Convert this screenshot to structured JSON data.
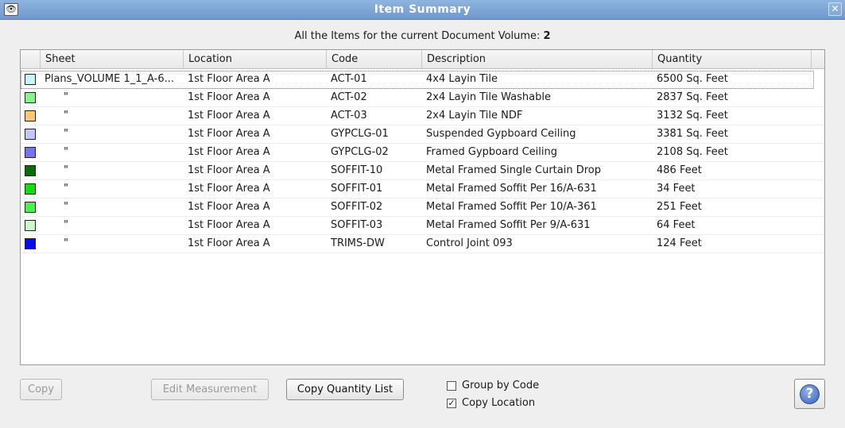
{
  "window": {
    "title": "Item Summary",
    "app_icon": "eye-icon",
    "close_icon": "close-icon",
    "close_glyph": "✕",
    "app_glyph": "👁"
  },
  "header": {
    "label": "All the Items for the current Document Volume:",
    "count": "2"
  },
  "table": {
    "columns": [
      "Sheet",
      "Location",
      "Code",
      "Description",
      "Quantity"
    ],
    "rows": [
      {
        "color": "#c8f4f8",
        "sheet": "Plans_VOLUME 1_1_A-6...",
        "location": "1st Floor Area A",
        "code": "ACT-01",
        "description": "4x4 Layin Tile",
        "quantity": "6500 Sq. Feet"
      },
      {
        "color": "#8ef08e",
        "sheet": "\"",
        "location": "1st Floor Area A",
        "code": "ACT-02",
        "description": "2x4 Layin Tile Washable",
        "quantity": "2837 Sq. Feet"
      },
      {
        "color": "#ffc873",
        "sheet": "\"",
        "location": "1st Floor Area A",
        "code": "ACT-03",
        "description": "2x4 Layin Tile NDF",
        "quantity": "3132 Sq. Feet"
      },
      {
        "color": "#c4c4f6",
        "sheet": "\"",
        "location": "1st Floor Area A",
        "code": "GYPCLG-01",
        "description": "Suspended Gypboard Ceiling",
        "quantity": "3381 Sq. Feet"
      },
      {
        "color": "#7474e8",
        "sheet": "\"",
        "location": "1st Floor Area A",
        "code": "GYPCLG-02",
        "description": "Framed Gypboard Ceiling",
        "quantity": "2108 Sq. Feet"
      },
      {
        "color": "#0a6b0a",
        "sheet": "\"",
        "location": "1st Floor Area A",
        "code": "SOFFIT-10",
        "description": "Metal Framed Single Curtain Drop",
        "quantity": "486 Feet"
      },
      {
        "color": "#11dd11",
        "sheet": "\"",
        "location": "1st Floor Area A",
        "code": "SOFFIT-01",
        "description": "Metal Framed Soffit Per 16/A-631",
        "quantity": "34 Feet"
      },
      {
        "color": "#4eee4e",
        "sheet": "\"",
        "location": "1st Floor Area A",
        "code": "SOFFIT-02",
        "description": "Metal Framed Soffit Per 10/A-361",
        "quantity": "251 Feet"
      },
      {
        "color": "#cdf7cd",
        "sheet": "\"",
        "location": "1st Floor Area A",
        "code": "SOFFIT-03",
        "description": "Metal Framed Soffit Per 9/A-631",
        "quantity": "64 Feet"
      },
      {
        "color": "#0a0aee",
        "sheet": "\"",
        "location": "1st Floor Area A",
        "code": "TRIMS-DW",
        "description": "Control Joint 093",
        "quantity": "124 Feet"
      }
    ]
  },
  "buttons": {
    "copy": "Copy",
    "edit_measurement": "Edit Measurement",
    "copy_quantity_list": "Copy Quantity List",
    "help_glyph": "?"
  },
  "options": {
    "group_by_code": {
      "label": "Group by Code",
      "checked": false
    },
    "copy_location": {
      "label": "Copy Location",
      "checked": true
    }
  }
}
